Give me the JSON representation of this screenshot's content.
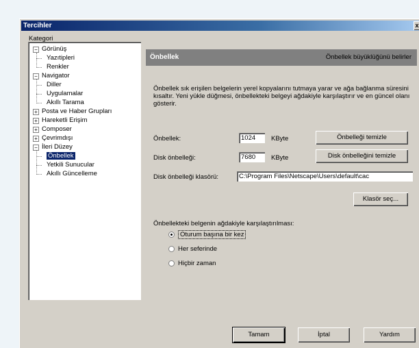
{
  "window": {
    "title": "Tercihler",
    "close_glyph": "x"
  },
  "category_label": "Kategori",
  "tree": {
    "items": [
      {
        "label": "Görünüş",
        "level": 0,
        "toggle": "−"
      },
      {
        "label": "Yazıtipleri",
        "level": 1
      },
      {
        "label": "Renkler",
        "level": 1
      },
      {
        "label": "Navigator",
        "level": 0,
        "toggle": "−"
      },
      {
        "label": "Diller",
        "level": 1
      },
      {
        "label": "Uygulamalar",
        "level": 1
      },
      {
        "label": "Akıllı Tarama",
        "level": 1
      },
      {
        "label": "Posta ve Haber Grupları",
        "level": 0,
        "toggle": "+"
      },
      {
        "label": "Hareketli Erişim",
        "level": 0,
        "toggle": "+"
      },
      {
        "label": "Composer",
        "level": 0,
        "toggle": "+"
      },
      {
        "label": "Çevrimdışı",
        "level": 0,
        "toggle": "+"
      },
      {
        "label": "İleri Düzey",
        "level": 0,
        "toggle": "−"
      },
      {
        "label": "Önbellek",
        "level": 1,
        "selected": true
      },
      {
        "label": "Yetkili Sunucular",
        "level": 1
      },
      {
        "label": "Akıllı Güncelleme",
        "level": 1
      }
    ]
  },
  "panel": {
    "title": "Önbellek",
    "subtitle": "Önbellek büyüklüğünü belirler",
    "description": "Önbellek sık erişilen belgelerin yerel kopyalarını tutmaya yarar ve ağa bağlanma süresini kısaltır. Yeni yükle düğmesi, önbellekteki belgeyi ağdakiyle karşılaştırır ve en güncel olanı gösterir.",
    "memory_cache": {
      "label": "Önbellek:",
      "value": "1024",
      "unit": "KByte",
      "button": "Önbelleği temizle"
    },
    "disk_cache": {
      "label": "Disk önbelleği:",
      "value": "7680",
      "unit": "KByte",
      "button": "Disk önbelleğini temizle"
    },
    "disk_folder": {
      "label": "Disk önbelleği klasörü:",
      "value": "C:\\Program Files\\Netscape\\Users\\default\\cac",
      "browse_button": "Klasör seç..."
    },
    "compare": {
      "label": "Önbellekteki belgenin ağdakiyle karşılaştırılması:",
      "options": [
        {
          "label": "Oturum başına bir kez",
          "checked": true
        },
        {
          "label": "Her seferinde",
          "checked": false
        },
        {
          "label": "Hiçbir zaman",
          "checked": false
        }
      ]
    }
  },
  "footer": {
    "ok": "Tamam",
    "cancel": "İptal",
    "help": "Yardım"
  }
}
